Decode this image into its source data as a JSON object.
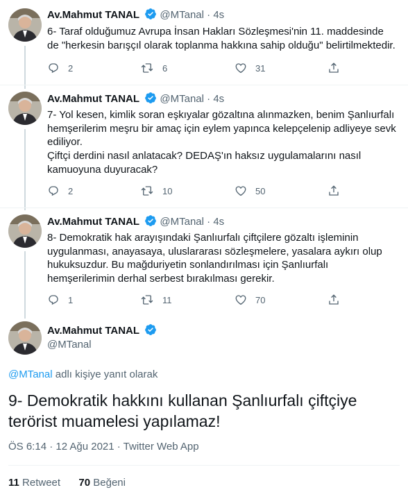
{
  "colors": {
    "accent": "#1d9bf0",
    "muted": "#536471",
    "text": "#0f1419",
    "divider": "#eff3f4"
  },
  "icons": {
    "verified": "verified-badge-icon",
    "reply": "reply-icon",
    "retweet": "retweet-icon",
    "like": "like-icon",
    "share": "share-icon"
  },
  "tweets": [
    {
      "name": "Av.Mahmut TANAL",
      "handle": "@MTanal",
      "dot": "·",
      "time": "4s",
      "text": "6- Taraf olduğumuz Avrupa İnsan Hakları Sözleşmesi'nin 11. maddesinde de \"herkesin barışçıl olarak toplanma hakkına sahip olduğu\" belirtilmektedir.",
      "replies": "2",
      "retweets": "6",
      "likes": "31"
    },
    {
      "name": "Av.Mahmut TANAL",
      "handle": "@MTanal",
      "dot": "·",
      "time": "4s",
      "text": "7- Yol kesen, kimlik soran eşkıyalar gözaltına alınmazken, benim Şanlıurfalı hemşerilerim meşru bir amaç için eylem yapınca kelepçelenip adliyeye sevk ediliyor.",
      "text2": "Çiftçi derdini nasıl anlatacak? DEDAŞ'ın haksız uygulamalarını nasıl kamuoyuna duyuracak?",
      "replies": "2",
      "retweets": "10",
      "likes": "50"
    },
    {
      "name": "Av.Mahmut TANAL",
      "handle": "@MTanal",
      "dot": "·",
      "time": "4s",
      "text": "8- Demokratik hak arayışındaki Şanlıurfalı çiftçilere gözaltı işleminin uygulanması, anayasaya, uluslararası sözleşmelere, yasalara aykırı olup hukuksuzdur. Bu mağduriyetin sonlandırılması için Şanlıurfalı hemşerilerimin derhal serbest bırakılması gerekir.",
      "replies": "1",
      "retweets": "11",
      "likes": "70"
    }
  ],
  "main": {
    "name": "Av.Mahmut TANAL",
    "handle": "@MTanal",
    "reply_to_handle": "@MTanal",
    "reply_to_suffix": " adlı kişiye yanıt olarak",
    "text": "9- Demokratik hakkını kullanan Şanlıurfalı çiftçiye terörist muamelesi yapılamaz!",
    "timestamp": "ÖS 6:14 · 12 Ağu 2021 · Twitter Web App",
    "retweet_count": "11",
    "retweet_label": "Retweet",
    "like_count": "70",
    "like_label": "Beğeni"
  }
}
